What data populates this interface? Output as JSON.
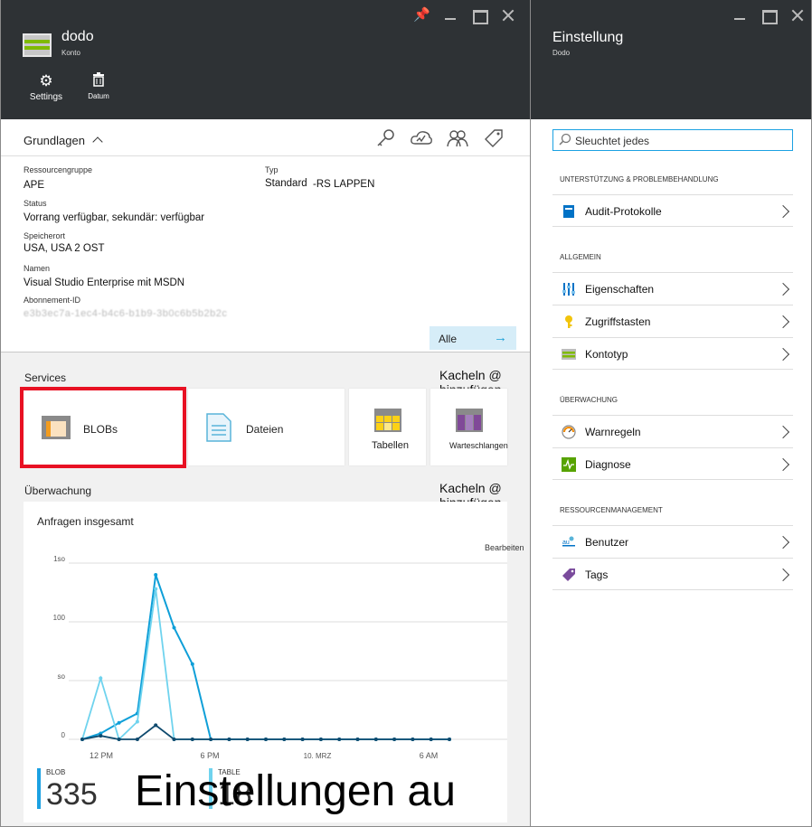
{
  "left": {
    "title": "dodo",
    "subtitle": "Konto",
    "commands": [
      {
        "label": "Settings",
        "icon": "gear-icon"
      },
      {
        "label": "Datum",
        "icon": "trash-icon"
      }
    ],
    "essentials": {
      "heading": "Grundlagen",
      "fields": {
        "resource_group_label": "Ressourcengruppe",
        "resource_group_value": "APE",
        "status_label": "Status",
        "status_value": "Vorrang verfügbar, sekundär: verfügbar",
        "location_label": "Speicherort",
        "location_value": "USA, USA 2 OST",
        "name_label": "Namen",
        "name_value": "Visual Studio Enterprise mit MSDN",
        "subscription_label": "Abonnement-ID",
        "subscription_value": "e3b3ec7a-1ec4-b4c6-b1b9-3b0c6b5b2b2c",
        "type_label": "Typ",
        "type_value_1": "Standard",
        "type_value_2": "-RS LAPPEN"
      },
      "all_button": "Alle"
    },
    "services": {
      "heading": "Services",
      "add_tiles": "Kacheln @ hinzufügen",
      "tiles": [
        {
          "label": "BLOBs",
          "icon": "blob-icon"
        },
        {
          "label": "Dateien",
          "icon": "file-icon"
        },
        {
          "label": "Tabellen",
          "icon": "table-icon"
        },
        {
          "label": "Warteschlangen",
          "icon": "queue-icon"
        }
      ]
    },
    "monitoring": {
      "heading": "Überwachung",
      "add_tiles": "Kacheln @ hinzufügen",
      "chart_title": "Anfragen insgesamt",
      "edit": "Bearbeiten",
      "legend": [
        {
          "name": "BLOB",
          "value": "335"
        },
        {
          "name": "TABLE",
          "value": "18"
        }
      ]
    },
    "overlay_text": "Einstellungen au"
  },
  "chart_data": {
    "type": "line",
    "title": "Anfragen insgesamt",
    "yticks": [
      "0",
      "so",
      "100",
      "1so"
    ],
    "ylim": [
      0,
      150
    ],
    "xticks": [
      "12 PM",
      "6 PM",
      "10. MRZ",
      "6 AM"
    ],
    "series": [
      {
        "name": "BLOB",
        "color": "#0f9fd8",
        "values": [
          0,
          5,
          14,
          22,
          140,
          95,
          64,
          0,
          0,
          0,
          0,
          0,
          0,
          0,
          0,
          0,
          0,
          0,
          0,
          0,
          0
        ]
      },
      {
        "name": "TABLE",
        "color": "#6fd3ee",
        "values": [
          0,
          52,
          0,
          15,
          128,
          0,
          0,
          0,
          0,
          0,
          0,
          0,
          0,
          0,
          0,
          0,
          0,
          0,
          0,
          0,
          0
        ]
      },
      {
        "color": "#0f4a6e",
        "values": [
          0,
          3,
          0,
          0,
          12,
          0,
          0,
          0,
          0,
          0,
          0,
          0,
          0,
          0,
          0,
          0,
          0,
          0,
          0,
          0,
          0
        ]
      }
    ]
  },
  "right": {
    "title": "Einstellung",
    "subtitle": "Dodo",
    "search_placeholder": "Sleuchtet jedes",
    "groups": [
      {
        "label": "UNTERSTÜTZUNG & PROBLEMBEHANDLUNG",
        "items": [
          {
            "label": "Audit-Protokolle",
            "icon": "audit-log-icon",
            "color": "#0072c6"
          }
        ]
      },
      {
        "label": "ALLGEMEIN",
        "items": [
          {
            "label": "Eigenschaften",
            "icon": "properties-icon",
            "color": "#0072c6"
          },
          {
            "label": "Zugriffstasten",
            "icon": "key-icon",
            "color": "#f2c40c"
          },
          {
            "label": "Kontotyp",
            "icon": "account-type-icon",
            "color": "#7fba00"
          }
        ]
      },
      {
        "label": "ÜBERWACHUNG",
        "items": [
          {
            "label": "Warnregeln",
            "icon": "alert-rules-icon",
            "color": "#f28a00"
          },
          {
            "label": "Diagnose",
            "icon": "diagnostics-icon",
            "color": "#57a300"
          }
        ]
      },
      {
        "label": "RESSOURCENMANAGEMENT",
        "items": [
          {
            "label": "Benutzer",
            "icon": "users-icon",
            "color": "#0072c6"
          },
          {
            "label": "Tags",
            "icon": "tag-icon",
            "color": "#7a4b9c"
          }
        ]
      }
    ]
  }
}
